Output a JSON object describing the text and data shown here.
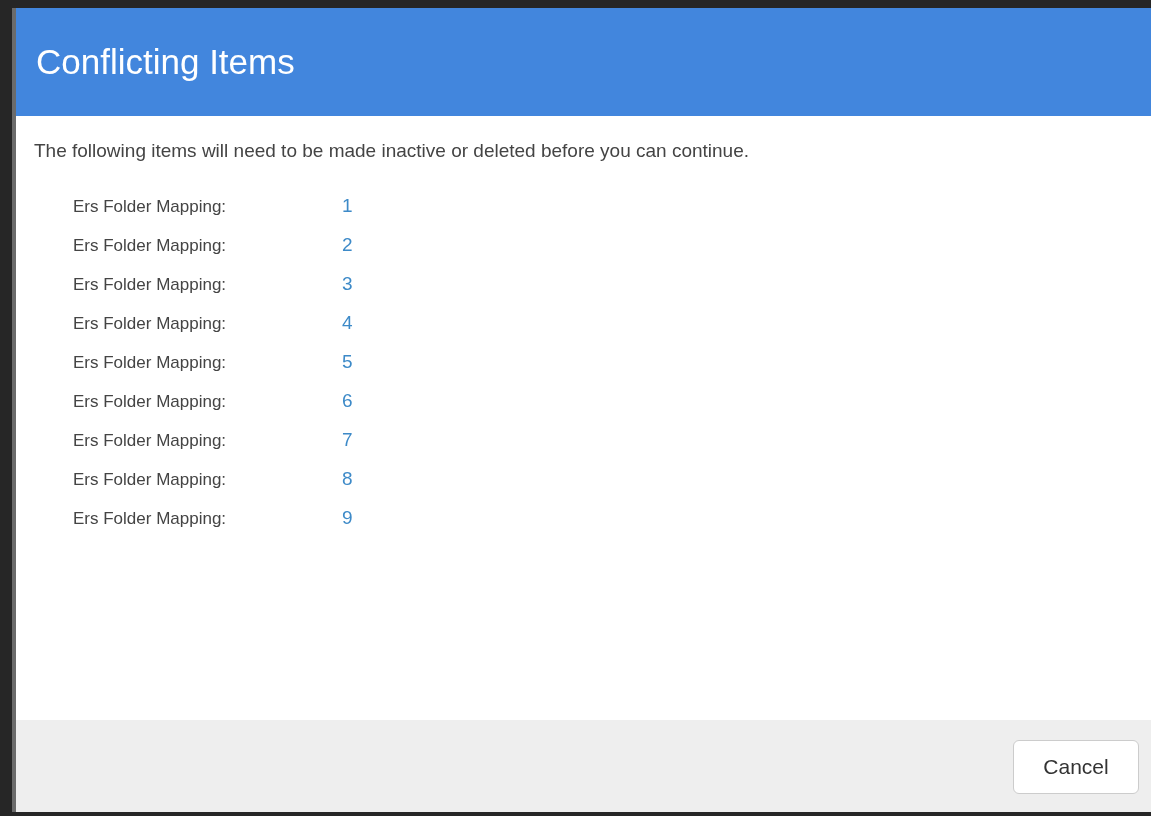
{
  "dialog": {
    "title": "Conflicting Items",
    "message": "The following items will need to be made inactive or deleted before you can continue.",
    "items": [
      {
        "label": "Ers Folder Mapping:",
        "value": "1"
      },
      {
        "label": "Ers Folder Mapping:",
        "value": "2"
      },
      {
        "label": "Ers Folder Mapping:",
        "value": "3"
      },
      {
        "label": "Ers Folder Mapping:",
        "value": "4"
      },
      {
        "label": "Ers Folder Mapping:",
        "value": "5"
      },
      {
        "label": "Ers Folder Mapping:",
        "value": "6"
      },
      {
        "label": "Ers Folder Mapping:",
        "value": "7"
      },
      {
        "label": "Ers Folder Mapping:",
        "value": "8"
      },
      {
        "label": "Ers Folder Mapping:",
        "value": "9"
      }
    ],
    "buttons": [
      "Cancel"
    ]
  }
}
